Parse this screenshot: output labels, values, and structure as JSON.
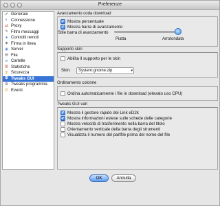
{
  "window": {
    "title": "Preferenze"
  },
  "sidebar": {
    "items": [
      {
        "label": "Generale",
        "icon": "✔",
        "icon_name": "general-icon",
        "icon_color": "#2e7d32"
      },
      {
        "label": "Connessione",
        "icon": "◐",
        "icon_name": "connection-icon",
        "icon_color": "#1e6fd9"
      },
      {
        "label": "Proxy",
        "icon": "⇄",
        "icon_name": "proxy-icon",
        "icon_color": "#cc3d2f"
      },
      {
        "label": "Filtro messaggi",
        "icon": "✎",
        "icon_name": "message-filter-icon",
        "icon_color": "#666666"
      },
      {
        "label": "Controlli remoti",
        "icon": "●",
        "icon_name": "remote-controls-icon",
        "icon_color": "#3a7bd5"
      },
      {
        "label": "Firma in linea",
        "icon": "◆",
        "icon_name": "online-signature-icon",
        "icon_color": "#888888"
      },
      {
        "label": "Server",
        "icon": "◉",
        "icon_name": "server-icon",
        "icon_color": "#4a89dc"
      },
      {
        "label": "File",
        "icon": "▤",
        "icon_name": "file-icon",
        "icon_color": "#777777"
      },
      {
        "label": "Cartelle",
        "icon": "▰",
        "icon_name": "folders-icon",
        "icon_color": "#8bb6e8"
      },
      {
        "label": "Statistiche",
        "icon": "▥",
        "icon_name": "statistics-icon",
        "icon_color": "#d9534f"
      },
      {
        "label": "Sicurezza",
        "icon": "⚿",
        "icon_name": "security-icon",
        "icon_color": "#c98a1a"
      },
      {
        "label": "Tweaks GUI",
        "icon": "⚙",
        "icon_name": "tweaks-gui-icon",
        "icon_color": "#ffffff",
        "selected": true
      },
      {
        "label": "Tweaks programma",
        "icon": "⚙",
        "icon_name": "tweaks-program-icon",
        "icon_color": "#555555"
      },
      {
        "label": "Eventi",
        "icon": "◎",
        "icon_name": "events-icon",
        "icon_color": "#e07b00"
      }
    ]
  },
  "download_queue": {
    "title": "Avanzamento coda download",
    "show_percent": {
      "label": "Mostra percentuale",
      "checked": true
    },
    "show_bar": {
      "label": "Mostra barra di avanzamento",
      "checked": true
    },
    "style_label": "Stile barra di avanzamento",
    "style_value": 1,
    "slider_min_label": "Piatta",
    "slider_max_label": "Arrotondata"
  },
  "skin": {
    "title": "Supporto skin",
    "enable": {
      "label": "Abilita il supporto per le skin",
      "checked": false
    },
    "skin_label": "Skin:",
    "skin_value": "System:gnome.zip"
  },
  "columns": {
    "title": "Ordinamento colonne",
    "auto_sort": {
      "label": "Ordina automaticamente i file in download (elevato uso CPU)",
      "checked": false
    }
  },
  "misc": {
    "title": "Tweaks GUI vari",
    "options": [
      {
        "label": "Mostra il gestore rapido dei Link eD2k",
        "checked": true
      },
      {
        "label": "Mostra informazioni estese sulle schede delle categorie",
        "checked": true
      },
      {
        "label": "Mostra velocità di trasferimento nella barra del titolo",
        "checked": false
      },
      {
        "label": "Orientamento verticale della barra degli strumenti",
        "checked": false
      },
      {
        "label": "Visualizza il numero del partfile prima del nome del file",
        "checked": false
      }
    ]
  },
  "buttons": {
    "ok": "OK",
    "cancel": "Annulla"
  },
  "colors": {
    "accent": "#3875d7"
  }
}
